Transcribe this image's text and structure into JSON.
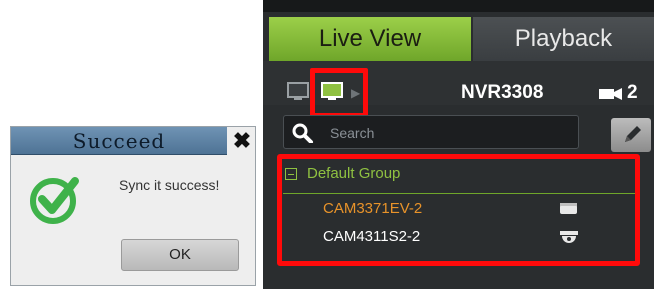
{
  "dialog": {
    "title": "Succeed",
    "close_glyph": "✖",
    "message": "Sync it success!",
    "ok_label": "OK",
    "icon": "checkmark-circle-icon"
  },
  "panel": {
    "tabs": [
      {
        "label": "Live View",
        "active": true
      },
      {
        "label": "Playback",
        "active": false
      }
    ],
    "device_name": "NVR3308",
    "camera_count": "2",
    "search": {
      "placeholder": "Search"
    },
    "group": {
      "label": "Default Group",
      "expanded": true
    },
    "cameras": [
      {
        "label": "CAM3371EV-2",
        "active": true,
        "icon": "bullet-camera-icon"
      },
      {
        "label": "CAM4311S2-2",
        "active": false,
        "icon": "dome-camera-icon"
      }
    ]
  },
  "colors": {
    "accent_green": "#8fc141",
    "highlight_red": "#ff0a0a",
    "active_camera": "#e8932a",
    "panel_bg": "#2a2d2f",
    "dialog_title": "#5b7fa1"
  }
}
